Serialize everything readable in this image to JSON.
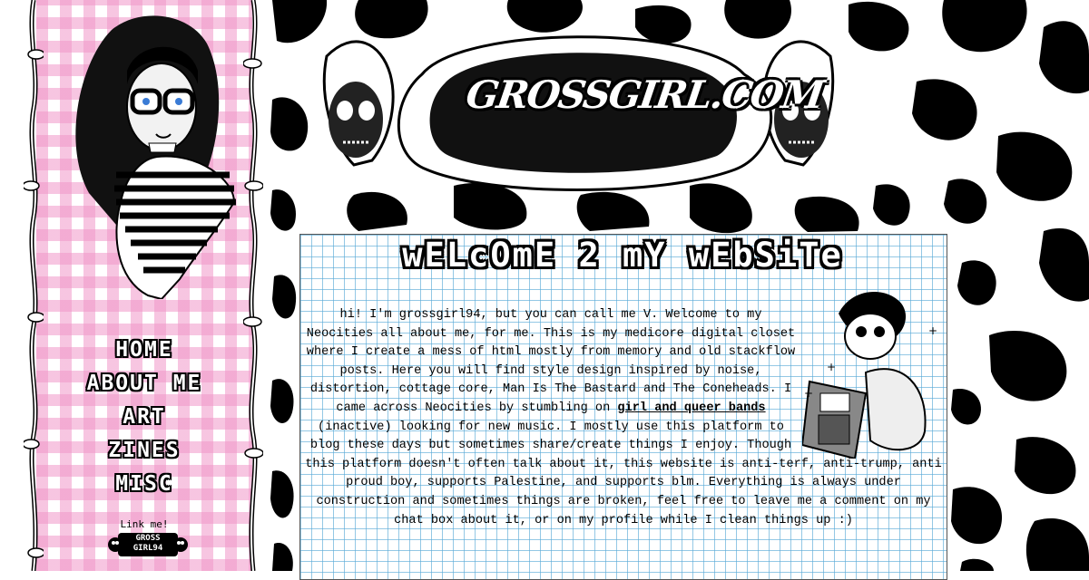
{
  "header": {
    "logo_text": "GROSSGIRL.COM"
  },
  "nav": {
    "items": [
      {
        "label": "HOME",
        "name": "nav-home"
      },
      {
        "label": "ABOUT ME",
        "name": "nav-about-me"
      },
      {
        "label": "ART",
        "name": "nav-art"
      },
      {
        "label": "ZINES",
        "name": "nav-zines"
      },
      {
        "label": "MISC",
        "name": "nav-misc"
      }
    ],
    "link_me": "Link me!",
    "badge_line1": "GROSS",
    "badge_line2": "GIRL94"
  },
  "main": {
    "title": "wELcOmE 2 mY wEbSiTe",
    "intro_1": "hi! I'm grossgirl94, but you can call me V. Welcome to my Neocities all about me, for me. This is my medicore digital closet where I create a mess of html mostly from memory and old stackflow posts. Here you will find style design inspired by noise, distortion, cottage core, Man Is The Bastard and The Coneheads. I came across Neocities by stumbling on ",
    "link_text": "girl and queer bands",
    "intro_2": " (inactive) looking for new music. I mostly use this platform to blog these days but sometimes share/create things I enjoy. Though this platform doesn't often talk about it, this website is anti-terf, anti-trump, anti proud boy, supports Palestine, and supports blm. Everything is always under construction and sometimes things are broken, feel free to leave me a comment on my chat box about it, or on my profile while I clean things up :)"
  },
  "colors": {
    "gingham": "#f096c8",
    "grid": "#5aaad7",
    "ink": "#000000",
    "paper": "#ffffff"
  },
  "icons": [
    "skull-icon",
    "vine-icon",
    "sparkle-icon"
  ]
}
